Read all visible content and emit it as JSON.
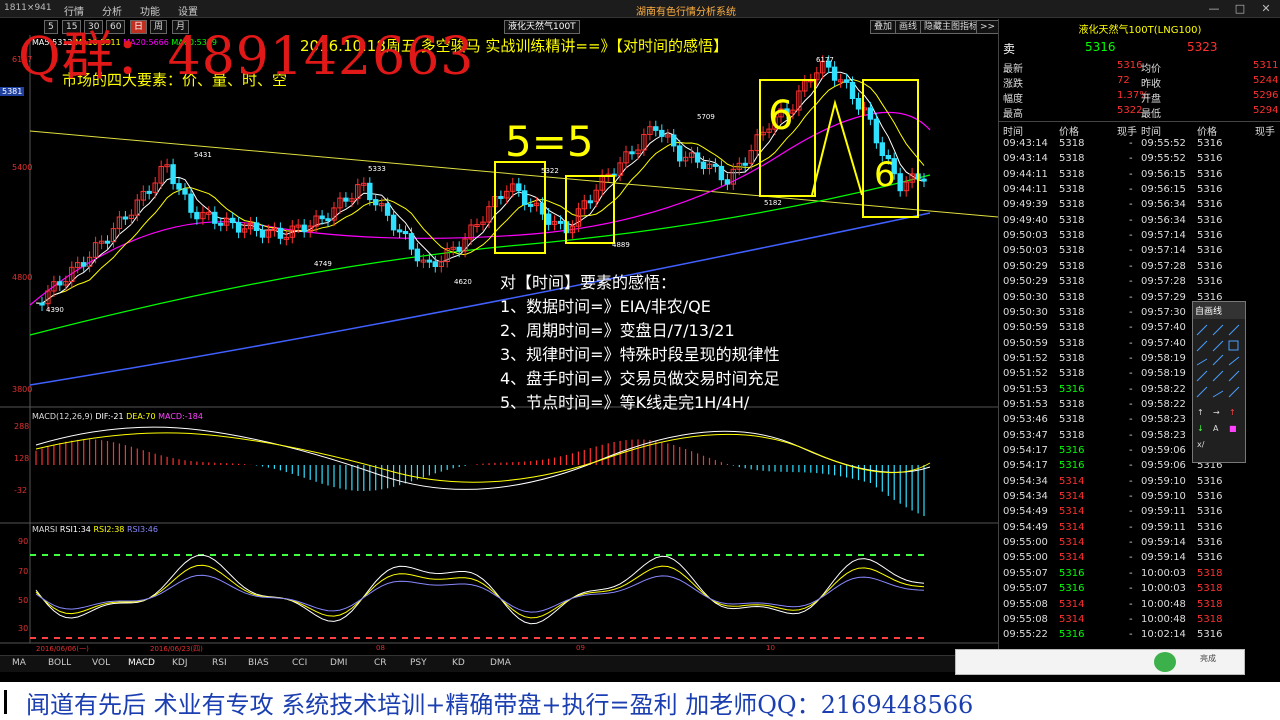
{
  "window": {
    "size_label": "1811×941",
    "menu": [
      "行情",
      "分析",
      "功能",
      "设置"
    ],
    "app_title": "湖南有色行情分析系统",
    "controls": [
      "—",
      "□",
      "✕"
    ]
  },
  "watermark": "Q群：489142663",
  "toolbar": {
    "periods": [
      "5",
      "15",
      "30",
      "60",
      "日",
      "周",
      "月"
    ],
    "active_period": "日",
    "symbol": "液化天然气100T",
    "right_buttons": [
      "叠加",
      "画线",
      "隐藏主图指标",
      ">>"
    ]
  },
  "main_chart": {
    "ma_legend": [
      {
        "text": "MA5:5312",
        "color": "#ffffff"
      },
      {
        "text": "MA10:5311",
        "color": "#ffff00"
      },
      {
        "text": "MA20:5666",
        "color": "#ff00ff"
      },
      {
        "text": "MA60:5319",
        "color": "#00ff00"
      }
    ],
    "headline": "2016.10.18周五 多空骏马 实战训练精讲==》【对时间的感悟】",
    "subline": "市场的四大要素：价、量、时、空",
    "price_axis": [
      "6177",
      "5400",
      "4800",
      "3800"
    ],
    "left_axis_tag": "5381",
    "price_notes": [
      "5431",
      "5333",
      "5322",
      "5709",
      "6177",
      "5182",
      "4889",
      "4749",
      "4620",
      "4390"
    ],
    "annotations": [
      "5=5",
      "6",
      "6"
    ],
    "time_notes": {
      "title": "对【时间】要素的感悟：",
      "items": [
        "1、数据时间=》EIA/非农/QE",
        "2、周期时间=》变盘日/7/13/21",
        "3、规律时间=》特殊时段呈现的规律性",
        "4、盘手时间=》交易员做交易时间充足",
        "5、节点时间=》等K线走完1H/4H/"
      ]
    }
  },
  "macd": {
    "legend": [
      {
        "text": "MACD(12,26,9)",
        "color": "#dddddd"
      },
      {
        "text": "DIF:-21",
        "color": "#ffffff"
      },
      {
        "text": "DEA:70",
        "color": "#ffff00"
      },
      {
        "text": "MACD:-184",
        "color": "#ff44ff"
      }
    ],
    "axis": [
      "288",
      "128",
      "-32"
    ]
  },
  "rsi": {
    "legend": [
      {
        "text": "MARSI",
        "color": "#dddddd"
      },
      {
        "text": "RSI1:34",
        "color": "#ffffff"
      },
      {
        "text": "RSI2:38",
        "color": "#ffff00"
      },
      {
        "text": "RSI3:46",
        "color": "#8888ff"
      }
    ],
    "axis": [
      "90",
      "70",
      "50",
      "30"
    ],
    "date_axis": [
      "2016/06/06(一)",
      "2016/06/23(四)",
      "08",
      "09",
      "10"
    ]
  },
  "quote": {
    "name": "液化天然气100T(LNG100)",
    "sell_label": "卖",
    "sell_price": "5316",
    "sell_qty": "5323",
    "stats_left": [
      {
        "k": "最新",
        "v": "5316"
      },
      {
        "k": "涨跌",
        "v": "72"
      },
      {
        "k": "幅度",
        "v": "1.37%"
      },
      {
        "k": "最高",
        "v": "5322"
      }
    ],
    "stats_right": [
      {
        "k": "均价",
        "v": "5311"
      },
      {
        "k": "昨收",
        "v": "5244"
      },
      {
        "k": "开盘",
        "v": "5296"
      },
      {
        "k": "最低",
        "v": "5294"
      }
    ],
    "tick_headers": [
      "时间",
      "价格",
      "现手",
      "时间",
      "价格",
      "现手"
    ],
    "ticks_left": [
      [
        "09:43:14",
        "5318",
        "-"
      ],
      [
        "09:43:14",
        "5318",
        "-"
      ],
      [
        "09:44:11",
        "5318",
        "-"
      ],
      [
        "09:44:11",
        "5318",
        "-"
      ],
      [
        "09:49:39",
        "5318",
        "-"
      ],
      [
        "09:49:40",
        "5318",
        "-"
      ],
      [
        "09:50:03",
        "5318",
        "-"
      ],
      [
        "09:50:03",
        "5318",
        "-"
      ],
      [
        "09:50:29",
        "5318",
        "-"
      ],
      [
        "09:50:29",
        "5318",
        "-"
      ],
      [
        "09:50:30",
        "5318",
        "-"
      ],
      [
        "09:50:30",
        "5318",
        "-"
      ],
      [
        "09:50:59",
        "5318",
        "-"
      ],
      [
        "09:50:59",
        "5318",
        "-"
      ],
      [
        "09:51:52",
        "5318",
        "-"
      ],
      [
        "09:51:52",
        "5318",
        "-"
      ],
      [
        "09:51:53",
        "5316",
        "-"
      ],
      [
        "09:51:53",
        "5318",
        "-"
      ],
      [
        "09:53:46",
        "5318",
        "-"
      ],
      [
        "09:53:47",
        "5318",
        "-"
      ],
      [
        "09:54:17",
        "5316",
        "-"
      ],
      [
        "09:54:17",
        "5316",
        "-"
      ],
      [
        "09:54:34",
        "5314",
        "-"
      ],
      [
        "09:54:34",
        "5314",
        "-"
      ],
      [
        "09:54:49",
        "5314",
        "-"
      ],
      [
        "09:54:49",
        "5314",
        "-"
      ],
      [
        "09:55:00",
        "5314",
        "-"
      ],
      [
        "09:55:00",
        "5314",
        "-"
      ],
      [
        "09:55:07",
        "5316",
        "-"
      ],
      [
        "09:55:07",
        "5316",
        "-"
      ],
      [
        "09:55:08",
        "5314",
        "-"
      ],
      [
        "09:55:08",
        "5314",
        "-"
      ],
      [
        "09:55:22",
        "5316",
        "-"
      ]
    ],
    "ticks_right": [
      [
        "09:55:52",
        "5316"
      ],
      [
        "09:55:52",
        "5316"
      ],
      [
        "09:56:15",
        "5316"
      ],
      [
        "09:56:15",
        "5316"
      ],
      [
        "09:56:34",
        "5316"
      ],
      [
        "09:56:34",
        "5316"
      ],
      [
        "09:57:14",
        "5316"
      ],
      [
        "09:57:14",
        "5316"
      ],
      [
        "09:57:28",
        "5316"
      ],
      [
        "09:57:28",
        "5316"
      ],
      [
        "09:57:29",
        "5316"
      ],
      [
        "09:57:30",
        "5316"
      ],
      [
        "09:57:40",
        "5316"
      ],
      [
        "09:57:40",
        "5316"
      ],
      [
        "09:58:19",
        "5316"
      ],
      [
        "09:58:19",
        "5316"
      ],
      [
        "09:58:22",
        "5316"
      ],
      [
        "09:58:22",
        "5316"
      ],
      [
        "09:58:23",
        "5316"
      ],
      [
        "09:58:23",
        "5316"
      ],
      [
        "09:59:06",
        "5316"
      ],
      [
        "09:59:06",
        "5316"
      ],
      [
        "09:59:10",
        "5316"
      ],
      [
        "09:59:10",
        "5316"
      ],
      [
        "09:59:11",
        "5316"
      ],
      [
        "09:59:11",
        "5316"
      ],
      [
        "09:59:14",
        "5316"
      ],
      [
        "09:59:14",
        "5316"
      ],
      [
        "10:00:03",
        "5318"
      ],
      [
        "10:00:03",
        "5318"
      ],
      [
        "10:00:48",
        "5318"
      ],
      [
        "10:00:48",
        "5318"
      ],
      [
        "10:02:14",
        "5316"
      ]
    ]
  },
  "bottom_tabs": [
    "MA",
    "BOLL",
    "VOL",
    "MACD",
    "KDJ",
    "RSI",
    "BIAS",
    "CCI",
    "DMI",
    "CR",
    "PSY",
    "KD",
    "DMA"
  ],
  "active_tab": "MACD",
  "draw_tools_title": "自画线",
  "taskbar_text": "亮成",
  "footer_ad": "闻道有先后 术业有专攻 系统技术培训+精确带盘+执行=盈利 加老师QQ：2169448566",
  "colors": {
    "up": "#ff3030",
    "down": "#30e0ff",
    "ma5": "#ffffff",
    "ma10": "#ffff00",
    "ma20": "#ff00ff",
    "ma60": "#00ff00",
    "ma120": "#4060ff",
    "annotation": "#ffff00",
    "accent": "#ffb040",
    "price_up": "#ff3030",
    "price_down": "#00ff00"
  }
}
